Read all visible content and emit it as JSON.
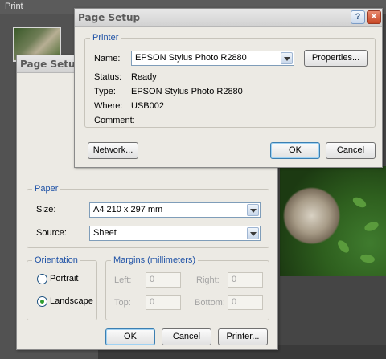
{
  "background_window": {
    "title": "Print"
  },
  "back_dialog": {
    "title": "Page Setup",
    "paper": {
      "group_label": "Paper",
      "size_label": "Size:",
      "size_value": "A4 210 x 297 mm",
      "source_label": "Source:",
      "source_value": "Sheet"
    },
    "orientation": {
      "group_label": "Orientation",
      "portrait_label": "Portrait",
      "landscape_label": "Landscape",
      "selected": "Landscape"
    },
    "margins": {
      "group_label": "Margins (millimeters)",
      "left_label": "Left:",
      "left_value": "0",
      "right_label": "Right:",
      "right_value": "0",
      "top_label": "Top:",
      "top_value": "0",
      "bottom_label": "Bottom:",
      "bottom_value": "0"
    },
    "buttons": {
      "ok": "OK",
      "cancel": "Cancel",
      "printer": "Printer..."
    }
  },
  "front_dialog": {
    "title": "Page Setup",
    "help_glyph": "?",
    "close_glyph": "✕",
    "printer": {
      "group_label": "Printer",
      "name_label": "Name:",
      "name_value": "EPSON Stylus Photo R2880",
      "properties_button": "Properties...",
      "status_label": "Status:",
      "status_value": "Ready",
      "type_label": "Type:",
      "type_value": "EPSON Stylus Photo R2880",
      "where_label": "Where:",
      "where_value": "USB002",
      "comment_label": "Comment:",
      "comment_value": ""
    },
    "buttons": {
      "network": "Network...",
      "ok": "OK",
      "cancel": "Cancel"
    }
  },
  "colors": {
    "group_label_blue": "#1f52a6",
    "dialog_bg": "#eceae4",
    "window_bg": "#454545"
  }
}
